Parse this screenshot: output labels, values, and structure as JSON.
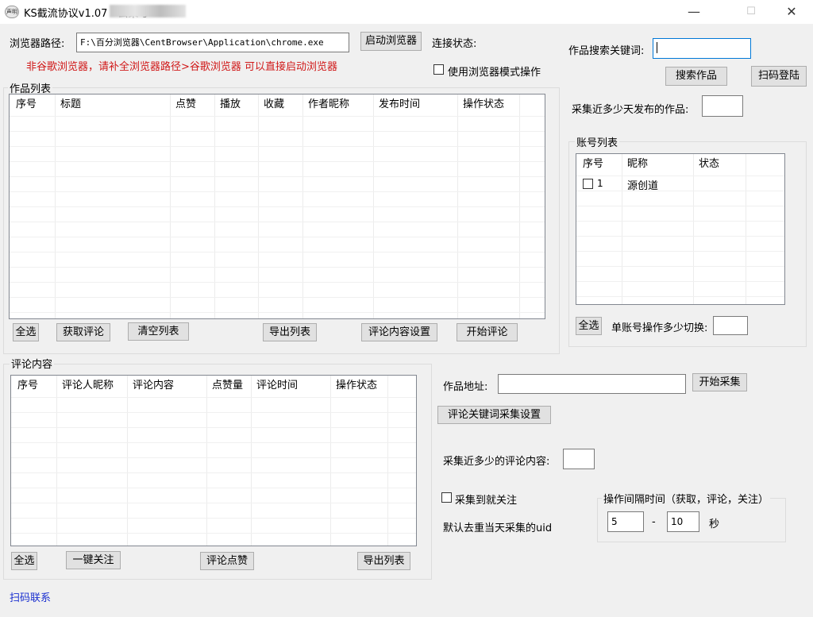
{
  "window": {
    "icon_text": "声明",
    "title": "KS截流协议v1.07 - 云聚号",
    "min": "—",
    "max": "☐",
    "close": "✕"
  },
  "top": {
    "browser_path_label": "浏览器路径:",
    "browser_path_value": "F:\\百分浏览器\\CentBrowser\\Application\\chrome.exe",
    "start_browser_btn": "启动浏览器",
    "connect_status_label": "连接状态:",
    "warning": "非谷歌浏览器，请补全浏览器路径>谷歌浏览器 可以直接启动浏览器",
    "browser_mode_label": "使用浏览器模式操作",
    "keyword_label": "作品搜索关键词:",
    "search_btn": "搜索作品",
    "scan_login_btn": "扫码登陆",
    "days_label": "采集近多少天发布的作品:"
  },
  "works": {
    "group_title": "作品列表",
    "columns": [
      "序号",
      "标题",
      "点赞",
      "播放",
      "收藏",
      "作者昵称",
      "发布时间",
      "操作状态"
    ],
    "buttons": {
      "select_all": "全选",
      "get_comments": "获取评论",
      "clear_list": "清空列表",
      "export_list": "导出列表",
      "comment_settings": "评论内容设置",
      "start_comment": "开始评论"
    }
  },
  "accounts": {
    "group_title": "账号列表",
    "columns": [
      "序号",
      "昵称",
      "状态"
    ],
    "rows": [
      {
        "index": "1",
        "nickname": "源创道",
        "status": ""
      }
    ],
    "select_all": "全选",
    "switch_label": "单账号操作多少切换:"
  },
  "comments": {
    "group_title": "评论内容",
    "columns": [
      "序号",
      "评论人昵称",
      "评论内容",
      "点赞量",
      "评论时间",
      "操作状态"
    ],
    "buttons": {
      "select_all": "全选",
      "follow_all": "一键关注",
      "like_comments": "评论点赞",
      "export_list": "导出列表"
    }
  },
  "collect": {
    "work_url_label": "作品地址:",
    "start_collect_btn": "开始采集",
    "keyword_settings_btn": "评论关键词采集设置",
    "recent_comments_label": "采集近多少的评论内容:",
    "follow_on_collect_label": "采集到就关注",
    "dedupe_label": "默认去重当天采集的uid",
    "interval_group_title": "操作间隔时间（获取，评论，关注）",
    "interval_min": "5",
    "interval_dash": "-",
    "interval_max": "10",
    "interval_unit": "秒"
  },
  "footer": {
    "scan_contact": "扫码联系"
  }
}
